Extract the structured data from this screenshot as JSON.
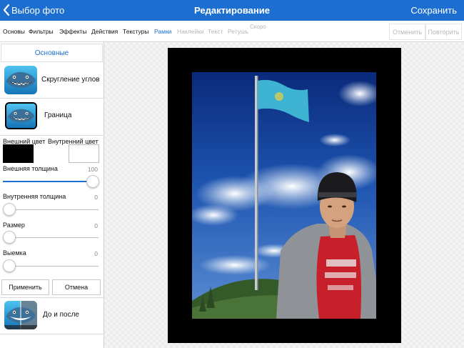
{
  "nav": {
    "back_label": "Выбор фото",
    "title": "Редактирование",
    "save_label": "Сохранить"
  },
  "tabs": [
    {
      "label": "Основы",
      "state": "normal"
    },
    {
      "label": "Фильтры",
      "state": "normal"
    },
    {
      "label": "Эффекты",
      "state": "normal"
    },
    {
      "label": "Действия",
      "state": "normal"
    },
    {
      "label": "Текстуры",
      "state": "normal"
    },
    {
      "label": "Рамки",
      "state": "active"
    },
    {
      "label": "Наклейки",
      "state": "disabled"
    },
    {
      "label": "Текст",
      "state": "disabled"
    },
    {
      "label": "Ретушь",
      "state": "disabled"
    },
    {
      "label": "Скоро",
      "state": "disabled"
    }
  ],
  "toolbar": {
    "undo_label": "Отменить",
    "redo_label": "Повторить"
  },
  "panel": {
    "header": "Основные",
    "rounded_corners_label": "Скругление углов",
    "border_label": "Граница",
    "outer_color_label": "Внешний цвет",
    "inner_color_label": "Внутренний цвет",
    "outer_color": "#000000",
    "inner_color": "#ffffff",
    "sliders": [
      {
        "label": "Внешняя толщина",
        "value": "100",
        "fraction": 1.0
      },
      {
        "label": "Внутренняя толщина",
        "value": "0",
        "fraction": 0.0
      },
      {
        "label": "Размер",
        "value": "0",
        "fraction": 0.0
      },
      {
        "label": "Выемка",
        "value": "0",
        "fraction": 0.0
      }
    ],
    "apply_label": "Применить",
    "cancel_label": "Отмена",
    "before_after_label": "До и после"
  },
  "colors": {
    "accent": "#1c6fd1",
    "frame": "#000000"
  },
  "icons": [
    "chevron-left-icon",
    "shark-app-icon",
    "before-after-icon"
  ]
}
